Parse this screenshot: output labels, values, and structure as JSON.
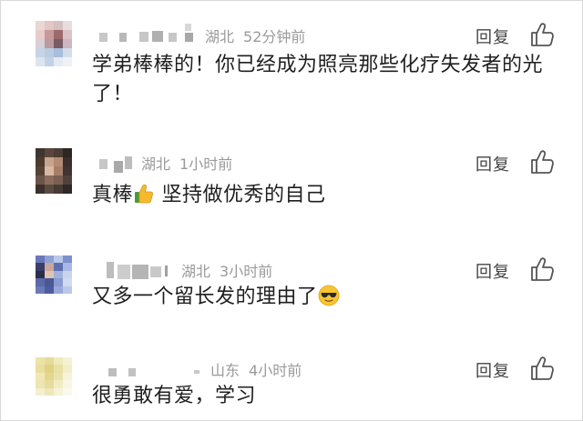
{
  "comments": [
    {
      "location": "湖北",
      "time": "52分钟前",
      "reply_label": "回复",
      "content_line1": "学弟棒棒的！你已经成为照亮那些化疗失发者的光",
      "content_line2": "了！"
    },
    {
      "location": "湖北",
      "time": "1小时前",
      "reply_label": "回复",
      "content_pre": "真棒",
      "content_post": "坚持做优秀的自己",
      "emoji": "thumbs-up-icon"
    },
    {
      "location": "湖北",
      "time": "3小时前",
      "reply_label": "回复",
      "content_pre": "又多一个留长发的理由了",
      "emoji": "sunglasses-face-icon"
    },
    {
      "location": "山东",
      "time": "4小时前",
      "reply_label": "回复",
      "content_pre": "很勇敢有爱，学习"
    }
  ],
  "colors": {
    "meta_text": "#9a9a9a",
    "content_text": "#1f1f1f",
    "reply_text": "#444444",
    "border": "#d8d8d8"
  }
}
